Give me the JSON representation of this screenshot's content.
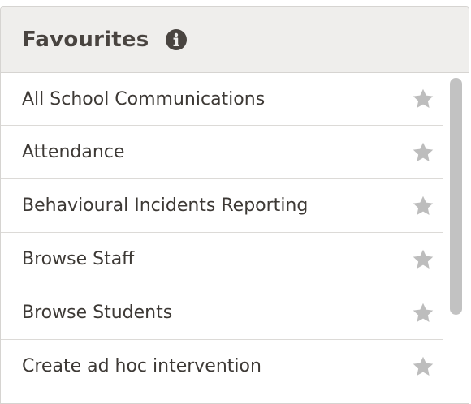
{
  "header": {
    "title": "Favourites",
    "info_icon": "info-circle-icon"
  },
  "items": [
    {
      "label": "All School Communications",
      "icon": "star-icon"
    },
    {
      "label": "Attendance",
      "icon": "star-icon"
    },
    {
      "label": "Behavioural Incidents Reporting",
      "icon": "star-icon"
    },
    {
      "label": "Browse Staff",
      "icon": "star-icon"
    },
    {
      "label": "Browse Students",
      "icon": "star-icon"
    },
    {
      "label": "Create ad hoc intervention",
      "icon": "star-icon"
    }
  ],
  "colors": {
    "header_bg": "#efeeec",
    "title": "#494440",
    "text": "#3d3935",
    "star": "#bdbdbd",
    "scroll_thumb": "#c2c2c2"
  }
}
